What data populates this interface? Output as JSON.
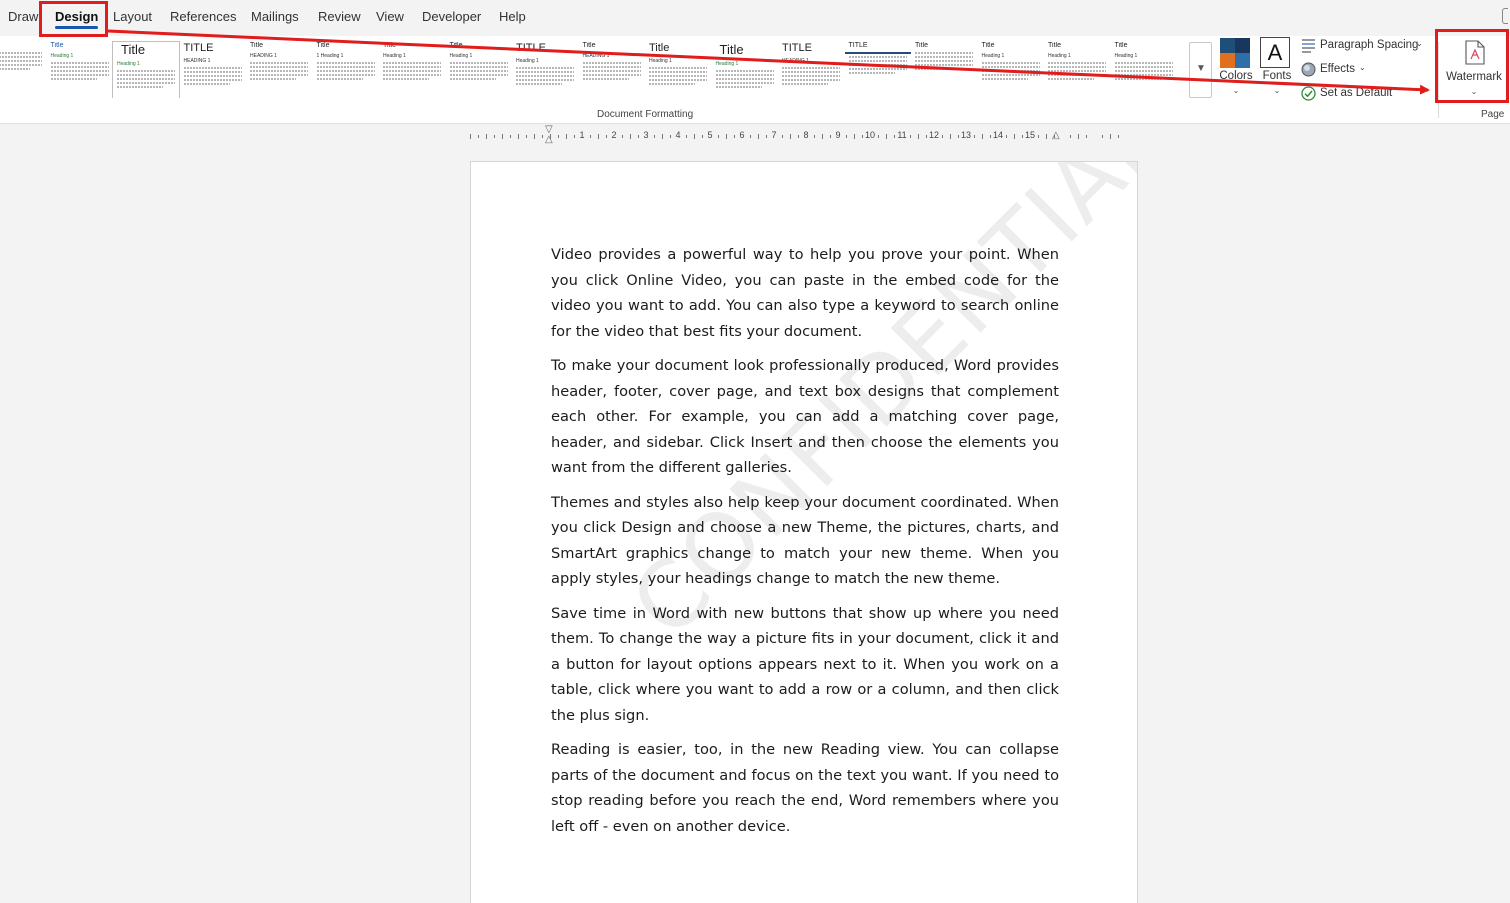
{
  "tabs": [
    {
      "label": "Draw",
      "active": false
    },
    {
      "label": "Design",
      "active": true
    },
    {
      "label": "Layout",
      "active": false
    },
    {
      "label": "References",
      "active": false
    },
    {
      "label": "Mailings",
      "active": false
    },
    {
      "label": "Review",
      "active": false
    },
    {
      "label": "View",
      "active": false
    },
    {
      "label": "Developer",
      "active": false
    },
    {
      "label": "Help",
      "active": false
    }
  ],
  "gallery": {
    "group_label": "Document Formatting",
    "items": [
      {
        "title": "",
        "heading": "",
        "style": "plain"
      },
      {
        "title": "Title",
        "heading": "Heading 1",
        "style": "blue"
      },
      {
        "title": "Title",
        "heading": "Heading 1",
        "style": "big"
      },
      {
        "title": "TITLE",
        "heading": "HEADING 1",
        "style": "mid"
      },
      {
        "title": "Title",
        "heading": "HEADING 1",
        "style": "small"
      },
      {
        "title": "Title",
        "heading": "1 Heading 1",
        "style": "small"
      },
      {
        "title": "Title",
        "heading": "Heading 1",
        "style": "small"
      },
      {
        "title": "Title",
        "heading": "Heading 1",
        "style": "small"
      },
      {
        "title": "TITLE",
        "heading": "Heading 1",
        "style": "mid"
      },
      {
        "title": "Title",
        "heading": "HEADING 1",
        "style": "small"
      },
      {
        "title": "Title",
        "heading": "Heading 1",
        "style": "mid"
      },
      {
        "title": "Title",
        "heading": "Heading 1",
        "style": "big"
      },
      {
        "title": "TITLE",
        "heading": "HEADING 1",
        "style": "mid"
      },
      {
        "title": "TITLE",
        "heading": "",
        "style": "bar"
      },
      {
        "title": "Title",
        "heading": "",
        "style": "small"
      },
      {
        "title": "Title",
        "heading": "Heading 1",
        "style": "small"
      },
      {
        "title": "Title",
        "heading": "Heading 1",
        "style": "small"
      },
      {
        "title": "Title",
        "heading": "Heading 1",
        "style": "small"
      }
    ]
  },
  "colors": {
    "label": "Colors",
    "swatches": [
      "#1f4e79",
      "#17375e",
      "#e07020",
      "#2e6fa8"
    ]
  },
  "fonts": {
    "label": "Fonts",
    "glyph": "A"
  },
  "paragraph_spacing": {
    "label": "Paragraph Spacing"
  },
  "effects": {
    "label": "Effects"
  },
  "set_default": {
    "label": "Set as Default"
  },
  "watermark": {
    "label": "Watermark"
  },
  "page_group_label": "Page",
  "ruler": {
    "numbers": [
      "1",
      "2",
      "3",
      "4",
      "5",
      "6",
      "7",
      "8",
      "9",
      "10",
      "11",
      "12",
      "13",
      "14",
      "15"
    ]
  },
  "document": {
    "paragraphs": [
      "Video provides a powerful way to help you prove your point. When you click Online Video, you can paste in the embed code for the video you want to add. You can also type a keyword to search online for the video that best fits your document.",
      "To make your document look professionally produced, Word provides header, footer, cover page, and text box designs that complement each other. For example, you can add a matching cover page, header, and sidebar. Click Insert and then choose the elements you want from the different galleries.",
      "Themes and styles also help keep your document coordinated. When you click Design and choose a new Theme, the pictures, charts, and SmartArt graphics change to match your new theme. When you apply styles, your headings change to match the new theme.",
      "Save time in Word with new buttons that show up where you need them. To change the way a picture fits in your document, click it and a button for layout options appears next to it. When you work on a table, click where you want to add a row or a column, and then click the plus sign.",
      "Reading is easier, too, in the new Reading view. You can collapse parts of the document and focus on the text you want. If you need to stop reading before you reach the end, Word remembers where you left off - even on another device."
    ],
    "watermark_text": "CONFIDENTIAL"
  },
  "annotation_color": "#e01c1c"
}
